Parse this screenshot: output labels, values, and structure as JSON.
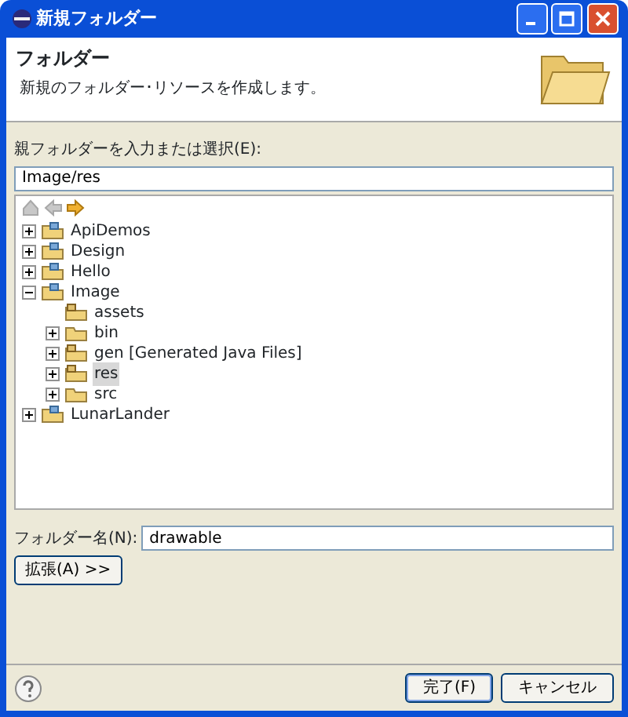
{
  "window": {
    "title": "新規フォルダー"
  },
  "header": {
    "title": "フォルダー",
    "description": "新規のフォルダー･リソースを作成します。"
  },
  "parent": {
    "label": "親フォルダーを入力または選択(E):",
    "value": "Image/res"
  },
  "tree_toolbar": [
    {
      "kind": "home",
      "disabled": true
    },
    {
      "kind": "back",
      "disabled": true
    },
    {
      "kind": "forward",
      "disabled": false
    }
  ],
  "tree": [
    {
      "label": "ApiDemos",
      "kind": "project",
      "expanded": false,
      "selected": false
    },
    {
      "label": "Design",
      "kind": "project",
      "expanded": false,
      "selected": false
    },
    {
      "label": "Hello",
      "kind": "project",
      "expanded": false,
      "selected": false
    },
    {
      "label": "Image",
      "kind": "project",
      "expanded": true,
      "selected": false,
      "children": [
        {
          "label": "assets",
          "kind": "source-folder",
          "selected": false
        },
        {
          "label": "bin",
          "kind": "folder",
          "expanded": false,
          "selected": false
        },
        {
          "label": "gen [Generated Java Files]",
          "kind": "source-folder",
          "expanded": false,
          "selected": false
        },
        {
          "label": "res",
          "kind": "source-folder",
          "expanded": false,
          "selected": true
        },
        {
          "label": "src",
          "kind": "folder",
          "expanded": false,
          "selected": false
        }
      ]
    },
    {
      "label": "LunarLander",
      "kind": "project",
      "expanded": false,
      "selected": false
    }
  ],
  "folder_name": {
    "label": "フォルダー名(N):",
    "value": "drawable"
  },
  "advanced_button": "拡張(A) >>",
  "buttons": [
    {
      "label": "完了(F)",
      "default": true
    },
    {
      "label": "キャンセル",
      "default": false
    }
  ]
}
